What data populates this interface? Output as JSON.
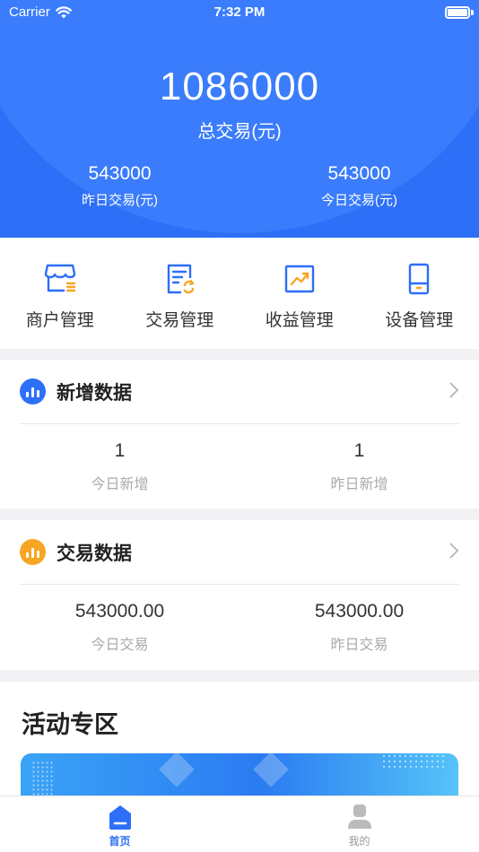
{
  "status_bar": {
    "carrier": "Carrier",
    "time": "7:32 PM"
  },
  "summary": {
    "total_value": "1086000",
    "total_label": "总交易(元)",
    "yesterday_value": "543000",
    "yesterday_label": "昨日交易(元)",
    "today_value": "543000",
    "today_label": "今日交易(元)"
  },
  "actions": [
    {
      "label": "商户管理",
      "icon": "store-icon"
    },
    {
      "label": "交易管理",
      "icon": "transaction-doc-icon"
    },
    {
      "label": "收益管理",
      "icon": "trend-chart-icon"
    },
    {
      "label": "设备管理",
      "icon": "device-icon"
    }
  ],
  "new_data": {
    "title": "新增数据",
    "badge_color": "#2d6ff7",
    "today_value": "1",
    "today_label": "今日新增",
    "yesterday_value": "1",
    "yesterday_label": "昨日新增"
  },
  "trade_data": {
    "title": "交易数据",
    "badge_color": "#f6a623",
    "today_value": "543000.00",
    "today_label": "今日交易",
    "yesterday_value": "543000.00",
    "yesterday_label": "昨日交易"
  },
  "activity": {
    "title": "活动专区"
  },
  "tabbar": {
    "home_label": "首页",
    "mine_label": "我的"
  },
  "colors": {
    "primary": "#2d6ff7",
    "accent_orange": "#f6a623"
  }
}
